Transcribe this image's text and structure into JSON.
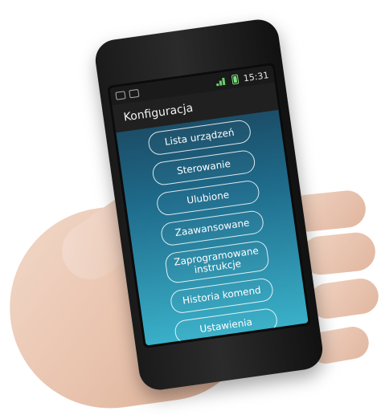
{
  "status_bar": {
    "time": "15:31"
  },
  "app": {
    "title": "Konfiguracja",
    "menu": [
      "Lista urządzeń",
      "Sterowanie",
      "Ulubione",
      "Zaawansowane",
      "Zaprogramowane\ninstrukcje",
      "Historia komend",
      "Ustawienia"
    ]
  },
  "colors": {
    "screen_gradient_top": "#1a3c52",
    "screen_gradient_bottom": "#3ab0c8",
    "header_bg": "#202020",
    "status_green": "#6bd16b"
  }
}
